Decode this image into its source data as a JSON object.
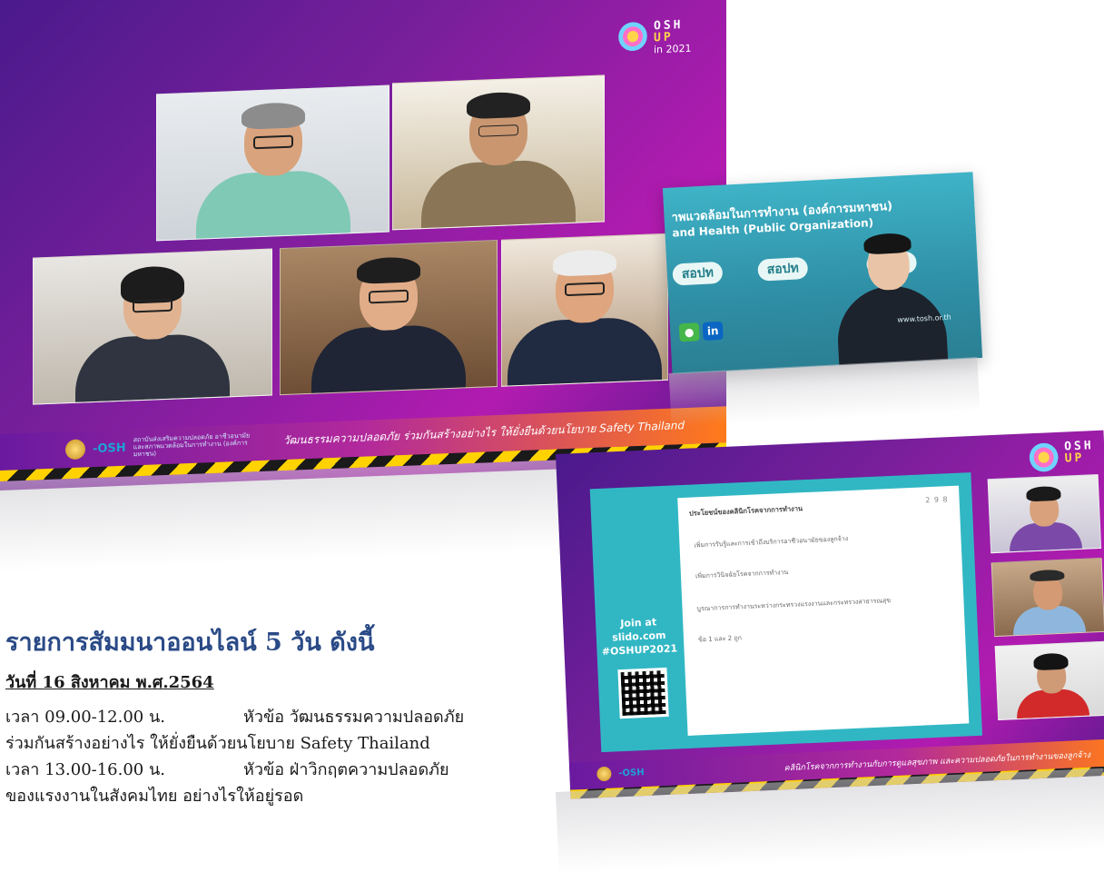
{
  "screens": {
    "main": {
      "logo": {
        "line1": "OSH",
        "line2": "UP",
        "line3": "in 2021"
      },
      "banner_title": "วัฒนธรรมความปลอดภัย ร่วมกันสร้างอย่างไร ให้ยั่งยืนด้วยนโยบาย Safety Thailand",
      "org_mark": "-OSH",
      "org_name": "สถาบันส่งเสริมความปลอดภัย อาชีวอนามัย และสภาพแวดล้อมในการทำงาน (องค์การมหาชน)"
    },
    "speaker": {
      "heading_line1": "าพแวดล้อมในการทำงาน (องค์การมหาชน)",
      "heading_line2": "and Health (Public Organization)",
      "logo_chips": [
        "สอปท",
        "สอปท",
        "สอปท"
      ],
      "social": [
        "in"
      ],
      "url": "www.tosh.or.th"
    },
    "slido": {
      "logo": {
        "line1": "OSH",
        "line2": "UP"
      },
      "join_text": "Join at\nslido.com\n#OSHUP2021",
      "question": "ประโยชน์ของคลินิกโรคจากการทำงาน",
      "count": "2 9 8",
      "options": [
        "เพิ่มการรับรู้และการเข้าถึงบริการอาชีวอนามัยของลูกจ้าง",
        "เพิ่มการวินิจฉัยโรคจากการทำงาน",
        "บูรณาการการทำงานระหว่างกระทรวงแรงงานและกระทรวงสาธารณสุข",
        "ข้อ 1 และ 2 ถูก"
      ],
      "bar_title": "คลินิกโรคจากการทำงานกับการดูแลสุขภาพ และความปลอดภัยในการทำงานของลูกจ้าง",
      "org_mark": "-OSH"
    }
  },
  "article": {
    "heading": "รายการสัมมนาออนไลน์ 5 วัน ดังนี้",
    "date": "วันที่ 16 สิงหาคม พ.ศ.2564",
    "sessions": [
      {
        "time": "เวลา 09.00-12.00 น.",
        "topic_line1": "หัวข้อ วัฒนธรรมความปลอดภัย",
        "topic_line2": "ร่วมกันสร้างอย่างไร ให้ยั่งยืนด้วยนโยบาย Safety Thailand"
      },
      {
        "time": "เวลา 13.00-16.00 น.",
        "topic_line1": "หัวข้อ ฝ่าวิกฤตความปลอดภัย",
        "topic_line2": "ของแรงงานในสังคมไทย อย่างไรให้อยู่รอด"
      }
    ]
  },
  "colors": {
    "heading": "#2a4a86",
    "stage_purple": "#7a1f9c",
    "stage_magenta": "#b21bb0",
    "slido_teal": "#31b7c4",
    "banner_orange": "#ff7a1a"
  }
}
